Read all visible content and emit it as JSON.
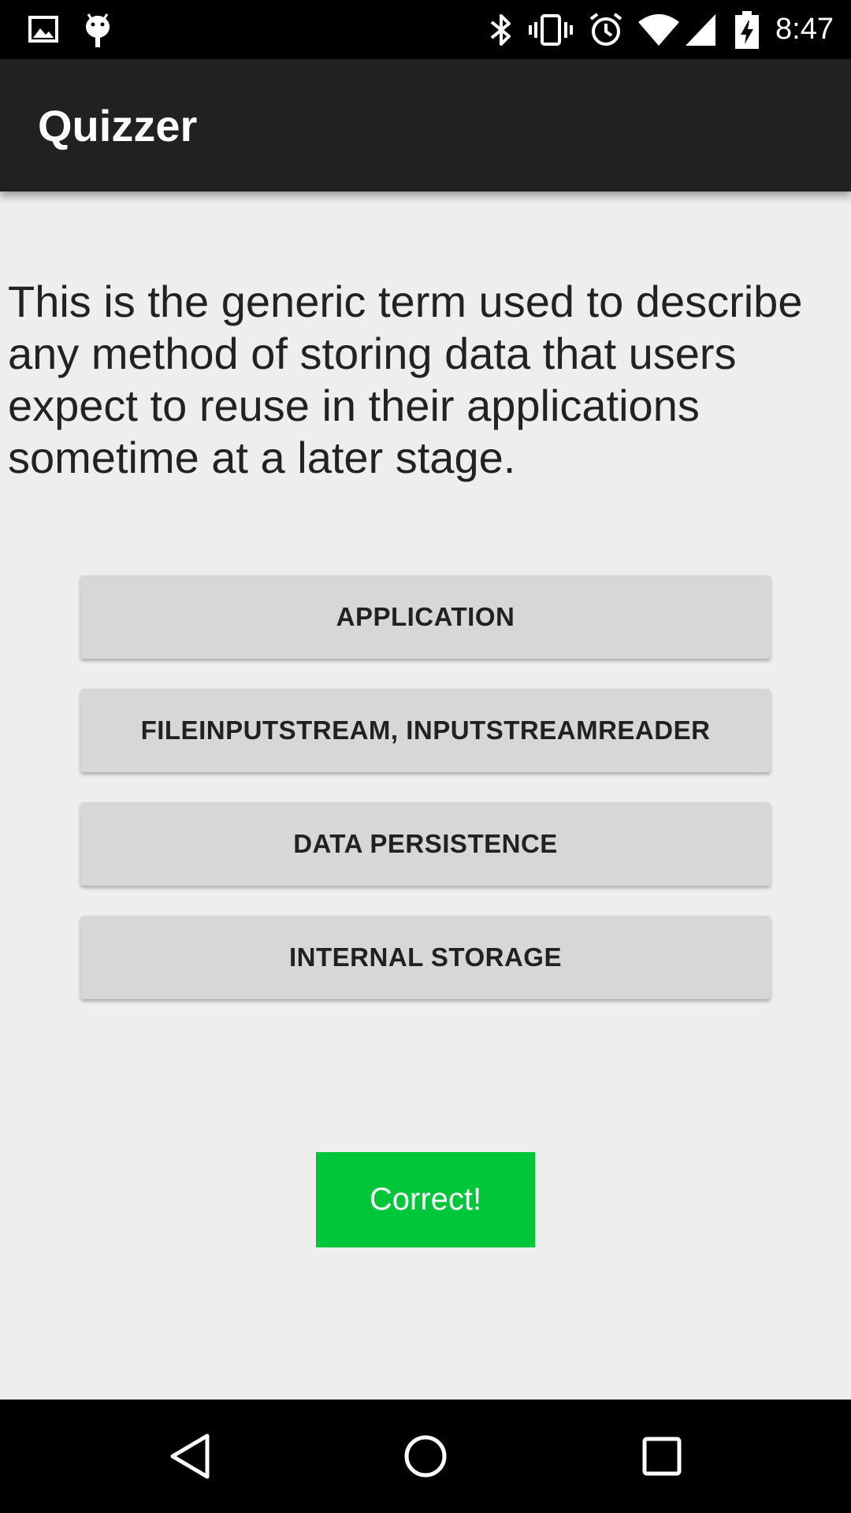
{
  "status_bar": {
    "time": "8:47",
    "left_icons": [
      "image-icon",
      "android-icon"
    ],
    "right_icons": [
      "bluetooth-icon",
      "vibrate-icon",
      "alarm-icon",
      "wifi-icon",
      "signal-icon",
      "battery-charging-icon"
    ]
  },
  "app_bar": {
    "title": "Quizzer"
  },
  "question": {
    "text": "This is the generic term used to describe any method of storing data that users expect to reuse in their applications sometime at a later stage."
  },
  "answers": [
    {
      "label": "APPLICATION"
    },
    {
      "label": "FILEINPUTSTREAM, INPUTSTREAMREADER"
    },
    {
      "label": "DATA PERSISTENCE"
    },
    {
      "label": "INTERNAL STORAGE"
    }
  ],
  "result": {
    "text": "Correct!",
    "color": "#00c73a"
  },
  "nav_bar": {
    "buttons": [
      "back-icon",
      "home-icon",
      "recents-icon"
    ]
  }
}
